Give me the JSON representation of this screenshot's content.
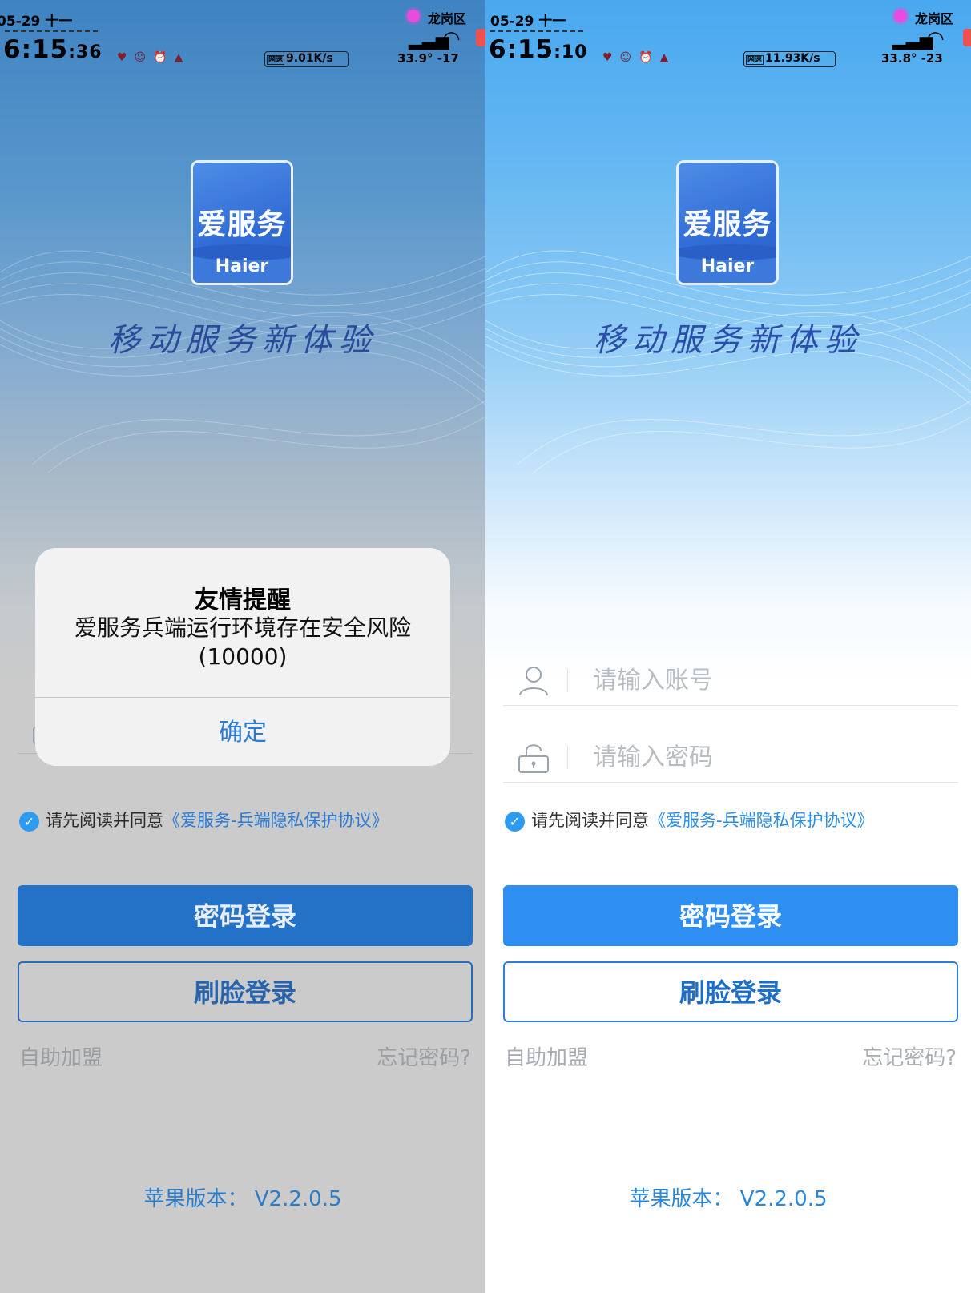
{
  "left": {
    "status": {
      "date": "05-29 十一",
      "time_hm": "6:15",
      "time_s": ":36",
      "net_tag": "网速",
      "net_speed": "9.01K/s",
      "location": "龙岗区",
      "weather": "33.9° -17"
    },
    "app_label": "爱服务",
    "brand": "Haier",
    "slogan": "移动服务新体验",
    "agree_prefix": "请先阅读并同意",
    "agree_link": "《爱服务-兵端隐私保护协议》",
    "password_login": "密码登录",
    "face_login": "刷脸登录",
    "self_join": "自助加盟",
    "forgot": "忘记密码?",
    "version": "苹果版本： V2.2.0.5",
    "alert": {
      "title": "友情提醒",
      "message": "爱服务兵端运行环境存在安全风险 (10000)",
      "ok": "确定"
    }
  },
  "right": {
    "status": {
      "date": "05-29 十一",
      "time_hm": "6:15",
      "time_s": ":10",
      "net_tag": "网速",
      "net_speed": "11.93K/s",
      "location": "龙岗区",
      "weather": "33.8° -23"
    },
    "app_label": "爱服务",
    "brand": "Haier",
    "slogan": "移动服务新体验",
    "account_placeholder": "请输入账号",
    "password_placeholder": "请输入密码",
    "agree_prefix": "请先阅读并同意",
    "agree_link": "《爱服务-兵端隐私保护协议》",
    "password_login": "密码登录",
    "face_login": "刷脸登录",
    "self_join": "自助加盟",
    "forgot": "忘记密码?",
    "version": "苹果版本： V2.2.0.5"
  },
  "colors": {
    "primary": "#2f8ef1",
    "link": "#2a8ee8",
    "slogan": "#2b4ea8"
  },
  "icons": {
    "user": "user-icon",
    "lock": "lock-icon",
    "check": "check-icon"
  }
}
